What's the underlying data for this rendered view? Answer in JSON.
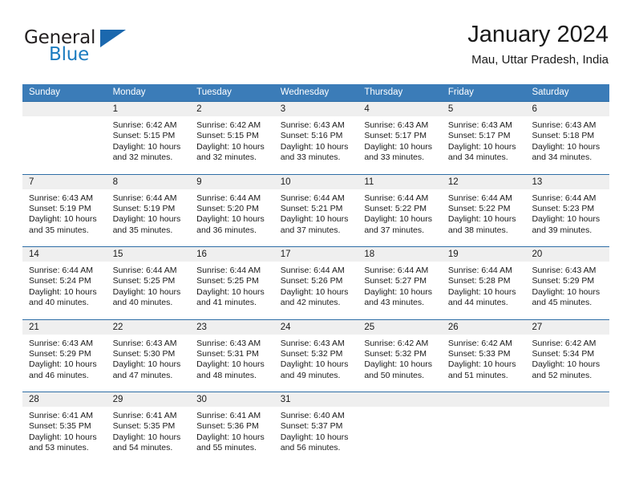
{
  "brand": {
    "name_part1": "General",
    "name_part2": "Blue",
    "triangle_color": "#1b68ae",
    "blue_color": "#1c7cc0"
  },
  "header": {
    "title": "January 2024",
    "subtitle": "Mau, Uttar Pradesh, India"
  },
  "theme": {
    "header_bg": "#3b7cb8",
    "header_text": "#ffffff",
    "row_divider": "#2f6ea6",
    "daynum_band": "#efefef"
  },
  "weekdays": [
    "Sunday",
    "Monday",
    "Tuesday",
    "Wednesday",
    "Thursday",
    "Friday",
    "Saturday"
  ],
  "labels": {
    "sunrise_prefix": "Sunrise:",
    "sunset_prefix": "Sunset:",
    "daylight_prefix": "Daylight:"
  },
  "weeks": [
    [
      {
        "day": "",
        "sunrise": "",
        "sunset": "",
        "daylight_line1": "",
        "daylight_line2": ""
      },
      {
        "day": "1",
        "sunrise": "Sunrise: 6:42 AM",
        "sunset": "Sunset: 5:15 PM",
        "daylight_line1": "Daylight: 10 hours",
        "daylight_line2": "and 32 minutes."
      },
      {
        "day": "2",
        "sunrise": "Sunrise: 6:42 AM",
        "sunset": "Sunset: 5:15 PM",
        "daylight_line1": "Daylight: 10 hours",
        "daylight_line2": "and 32 minutes."
      },
      {
        "day": "3",
        "sunrise": "Sunrise: 6:43 AM",
        "sunset": "Sunset: 5:16 PM",
        "daylight_line1": "Daylight: 10 hours",
        "daylight_line2": "and 33 minutes."
      },
      {
        "day": "4",
        "sunrise": "Sunrise: 6:43 AM",
        "sunset": "Sunset: 5:17 PM",
        "daylight_line1": "Daylight: 10 hours",
        "daylight_line2": "and 33 minutes."
      },
      {
        "day": "5",
        "sunrise": "Sunrise: 6:43 AM",
        "sunset": "Sunset: 5:17 PM",
        "daylight_line1": "Daylight: 10 hours",
        "daylight_line2": "and 34 minutes."
      },
      {
        "day": "6",
        "sunrise": "Sunrise: 6:43 AM",
        "sunset": "Sunset: 5:18 PM",
        "daylight_line1": "Daylight: 10 hours",
        "daylight_line2": "and 34 minutes."
      }
    ],
    [
      {
        "day": "7",
        "sunrise": "Sunrise: 6:43 AM",
        "sunset": "Sunset: 5:19 PM",
        "daylight_line1": "Daylight: 10 hours",
        "daylight_line2": "and 35 minutes."
      },
      {
        "day": "8",
        "sunrise": "Sunrise: 6:44 AM",
        "sunset": "Sunset: 5:19 PM",
        "daylight_line1": "Daylight: 10 hours",
        "daylight_line2": "and 35 minutes."
      },
      {
        "day": "9",
        "sunrise": "Sunrise: 6:44 AM",
        "sunset": "Sunset: 5:20 PM",
        "daylight_line1": "Daylight: 10 hours",
        "daylight_line2": "and 36 minutes."
      },
      {
        "day": "10",
        "sunrise": "Sunrise: 6:44 AM",
        "sunset": "Sunset: 5:21 PM",
        "daylight_line1": "Daylight: 10 hours",
        "daylight_line2": "and 37 minutes."
      },
      {
        "day": "11",
        "sunrise": "Sunrise: 6:44 AM",
        "sunset": "Sunset: 5:22 PM",
        "daylight_line1": "Daylight: 10 hours",
        "daylight_line2": "and 37 minutes."
      },
      {
        "day": "12",
        "sunrise": "Sunrise: 6:44 AM",
        "sunset": "Sunset: 5:22 PM",
        "daylight_line1": "Daylight: 10 hours",
        "daylight_line2": "and 38 minutes."
      },
      {
        "day": "13",
        "sunrise": "Sunrise: 6:44 AM",
        "sunset": "Sunset: 5:23 PM",
        "daylight_line1": "Daylight: 10 hours",
        "daylight_line2": "and 39 minutes."
      }
    ],
    [
      {
        "day": "14",
        "sunrise": "Sunrise: 6:44 AM",
        "sunset": "Sunset: 5:24 PM",
        "daylight_line1": "Daylight: 10 hours",
        "daylight_line2": "and 40 minutes."
      },
      {
        "day": "15",
        "sunrise": "Sunrise: 6:44 AM",
        "sunset": "Sunset: 5:25 PM",
        "daylight_line1": "Daylight: 10 hours",
        "daylight_line2": "and 40 minutes."
      },
      {
        "day": "16",
        "sunrise": "Sunrise: 6:44 AM",
        "sunset": "Sunset: 5:25 PM",
        "daylight_line1": "Daylight: 10 hours",
        "daylight_line2": "and 41 minutes."
      },
      {
        "day": "17",
        "sunrise": "Sunrise: 6:44 AM",
        "sunset": "Sunset: 5:26 PM",
        "daylight_line1": "Daylight: 10 hours",
        "daylight_line2": "and 42 minutes."
      },
      {
        "day": "18",
        "sunrise": "Sunrise: 6:44 AM",
        "sunset": "Sunset: 5:27 PM",
        "daylight_line1": "Daylight: 10 hours",
        "daylight_line2": "and 43 minutes."
      },
      {
        "day": "19",
        "sunrise": "Sunrise: 6:44 AM",
        "sunset": "Sunset: 5:28 PM",
        "daylight_line1": "Daylight: 10 hours",
        "daylight_line2": "and 44 minutes."
      },
      {
        "day": "20",
        "sunrise": "Sunrise: 6:43 AM",
        "sunset": "Sunset: 5:29 PM",
        "daylight_line1": "Daylight: 10 hours",
        "daylight_line2": "and 45 minutes."
      }
    ],
    [
      {
        "day": "21",
        "sunrise": "Sunrise: 6:43 AM",
        "sunset": "Sunset: 5:29 PM",
        "daylight_line1": "Daylight: 10 hours",
        "daylight_line2": "and 46 minutes."
      },
      {
        "day": "22",
        "sunrise": "Sunrise: 6:43 AM",
        "sunset": "Sunset: 5:30 PM",
        "daylight_line1": "Daylight: 10 hours",
        "daylight_line2": "and 47 minutes."
      },
      {
        "day": "23",
        "sunrise": "Sunrise: 6:43 AM",
        "sunset": "Sunset: 5:31 PM",
        "daylight_line1": "Daylight: 10 hours",
        "daylight_line2": "and 48 minutes."
      },
      {
        "day": "24",
        "sunrise": "Sunrise: 6:43 AM",
        "sunset": "Sunset: 5:32 PM",
        "daylight_line1": "Daylight: 10 hours",
        "daylight_line2": "and 49 minutes."
      },
      {
        "day": "25",
        "sunrise": "Sunrise: 6:42 AM",
        "sunset": "Sunset: 5:32 PM",
        "daylight_line1": "Daylight: 10 hours",
        "daylight_line2": "and 50 minutes."
      },
      {
        "day": "26",
        "sunrise": "Sunrise: 6:42 AM",
        "sunset": "Sunset: 5:33 PM",
        "daylight_line1": "Daylight: 10 hours",
        "daylight_line2": "and 51 minutes."
      },
      {
        "day": "27",
        "sunrise": "Sunrise: 6:42 AM",
        "sunset": "Sunset: 5:34 PM",
        "daylight_line1": "Daylight: 10 hours",
        "daylight_line2": "and 52 minutes."
      }
    ],
    [
      {
        "day": "28",
        "sunrise": "Sunrise: 6:41 AM",
        "sunset": "Sunset: 5:35 PM",
        "daylight_line1": "Daylight: 10 hours",
        "daylight_line2": "and 53 minutes."
      },
      {
        "day": "29",
        "sunrise": "Sunrise: 6:41 AM",
        "sunset": "Sunset: 5:35 PM",
        "daylight_line1": "Daylight: 10 hours",
        "daylight_line2": "and 54 minutes."
      },
      {
        "day": "30",
        "sunrise": "Sunrise: 6:41 AM",
        "sunset": "Sunset: 5:36 PM",
        "daylight_line1": "Daylight: 10 hours",
        "daylight_line2": "and 55 minutes."
      },
      {
        "day": "31",
        "sunrise": "Sunrise: 6:40 AM",
        "sunset": "Sunset: 5:37 PM",
        "daylight_line1": "Daylight: 10 hours",
        "daylight_line2": "and 56 minutes."
      },
      {
        "day": "",
        "sunrise": "",
        "sunset": "",
        "daylight_line1": "",
        "daylight_line2": ""
      },
      {
        "day": "",
        "sunrise": "",
        "sunset": "",
        "daylight_line1": "",
        "daylight_line2": ""
      },
      {
        "day": "",
        "sunrise": "",
        "sunset": "",
        "daylight_line1": "",
        "daylight_line2": ""
      }
    ]
  ]
}
